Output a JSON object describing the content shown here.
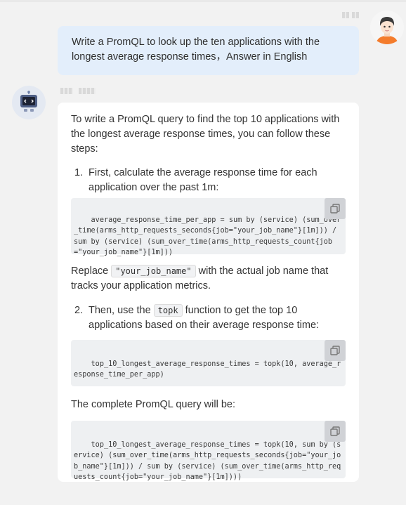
{
  "user_message": {
    "text": "Write a PromQL to look up the ten applications with the longest average response times，Answer in English"
  },
  "bot_message": {
    "intro": "To write a PromQL query to find the top 10 applications with the longest average response times, you can follow these steps:",
    "step1": {
      "number": "1.",
      "text": "First, calculate the average response time for each application over the past 1m:",
      "code": "average_response_time_per_app = sum by (service) (sum_over_time(arms_http_requests_seconds{job=\"your_job_name\"}[1m])) / sum by (service) (sum_over_time(arms_http_requests_count{job=\"your_job_name\"}[1m]))"
    },
    "replace_before": "Replace",
    "replace_code": "\"your_job_name\"",
    "replace_after": "with the actual job name that tracks your application metrics.",
    "step2": {
      "number": "2.",
      "text_before": "Then, use the",
      "inline_code": "topk",
      "text_after": "function to get the top 10 applications based on their average response time:",
      "code": "top_10_longest_average_response_times = topk(10, average_response_time_per_app)"
    },
    "complete_label": "The complete PromQL query will be:",
    "complete_code": "top_10_longest_average_response_times = topk(10, sum by (service) (sum_over_time(arms_http_requests_seconds{job=\"your_job_name\"}[1m])) / sum by (service) (sum_over_time(arms_http_requests_count{job=\"your_job_name\"}[1m])))"
  },
  "icons": {
    "copy": "copy-icon",
    "user_avatar": "user-avatar-icon",
    "bot_avatar": "bot-avatar-icon"
  },
  "colors": {
    "background": "#f2f2f2",
    "user_bubble": "#e3eefb",
    "bot_bubble": "#ffffff",
    "code_bg": "#eef0f2",
    "copy_button": "#d0d2d6"
  }
}
